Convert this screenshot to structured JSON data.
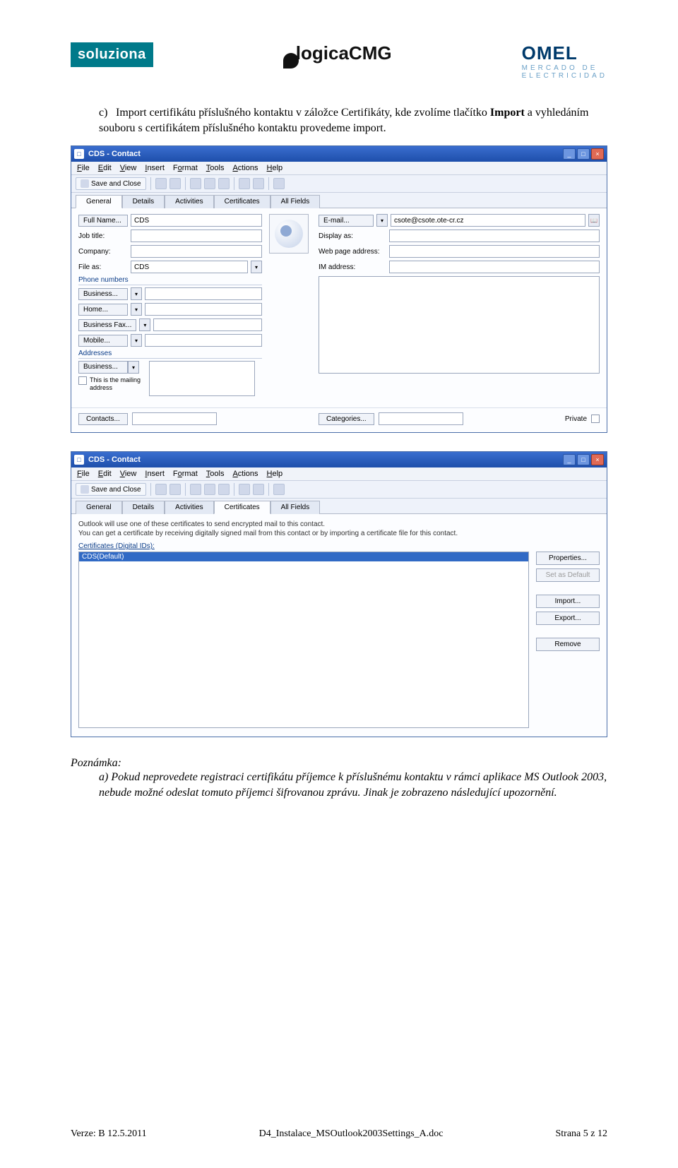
{
  "logos": {
    "soluziona": "soluziona",
    "logica": "logicaCMG",
    "omel_l1": "OMEL",
    "omel_l2": "MERCADO DE",
    "omel_l3": "ELECTRICIDAD"
  },
  "body": {
    "c_label": "c)",
    "c_text": "Import certifikátu příslušného kontaktu v záložce Certifikáty, kde zvolíme tlačítko ",
    "c_bold": "Import",
    "c_rest": " a vyhledáním souboru s certifikátem příslušného kontaktu provedeme import."
  },
  "win1": {
    "title": "CDS - Contact",
    "menu": [
      "File",
      "Edit",
      "View",
      "Insert",
      "Format",
      "Tools",
      "Actions",
      "Help"
    ],
    "save_close": "Save and Close",
    "tabs": [
      "General",
      "Details",
      "Activities",
      "Certificates",
      "All Fields"
    ],
    "active_tab_index": 0,
    "fields": {
      "full_name_btn": "Full Name...",
      "full_name_val": "CDS",
      "job_title": "Job title:",
      "company": "Company:",
      "file_as": "File as:",
      "file_as_val": "CDS",
      "phone_hdr": "Phone numbers",
      "business_btn": "Business...",
      "home_btn": "Home...",
      "bfax_btn": "Business Fax...",
      "mobile_btn": "Mobile...",
      "addr_hdr": "Addresses",
      "addr_business_btn": "Business...",
      "mailing_chk": "This is the mailing address",
      "email_btn": "E-mail...",
      "email_val": "csote@csote.ote-cr.cz",
      "display_as": "Display as:",
      "web_page": "Web page address:",
      "im_addr": "IM address:"
    },
    "bottom": {
      "contacts_btn": "Contacts...",
      "categories_btn": "Categories...",
      "private_lbl": "Private"
    }
  },
  "win2": {
    "title": "CDS - Contact",
    "menu": [
      "File",
      "Edit",
      "View",
      "Insert",
      "Format",
      "Tools",
      "Actions",
      "Help"
    ],
    "save_close": "Save and Close",
    "tabs": [
      "General",
      "Details",
      "Activities",
      "Certificates",
      "All Fields"
    ],
    "active_tab_index": 3,
    "desc": "Outlook will use one of these certificates to send encrypted mail to this contact.\nYou can get a certificate by receiving digitally signed mail from this contact or by importing a certificate file for this contact.",
    "list_label": "Certificates (Digital IDs):",
    "list_selected": "CDS(Default)",
    "buttons": {
      "properties": "Properties...",
      "set_default": "Set as Default",
      "import": "Import...",
      "export": "Export...",
      "remove": "Remove"
    }
  },
  "note": {
    "head": "Poznámka:",
    "a_label": "a)",
    "a_text": "Pokud neprovedete registraci certifikátu příjemce k příslušnému kontaktu v rámci aplikace MS Outlook 2003, nebude možné odeslat tomuto příjemci šifrovanou zprávu. Jinak je zobrazeno následující upozornění."
  },
  "footer": {
    "left": "Verze: B   12.5.2011",
    "center": "D4_Instalace_MSOutlook2003Settings_A.doc",
    "right": "Strana 5 z 12"
  }
}
